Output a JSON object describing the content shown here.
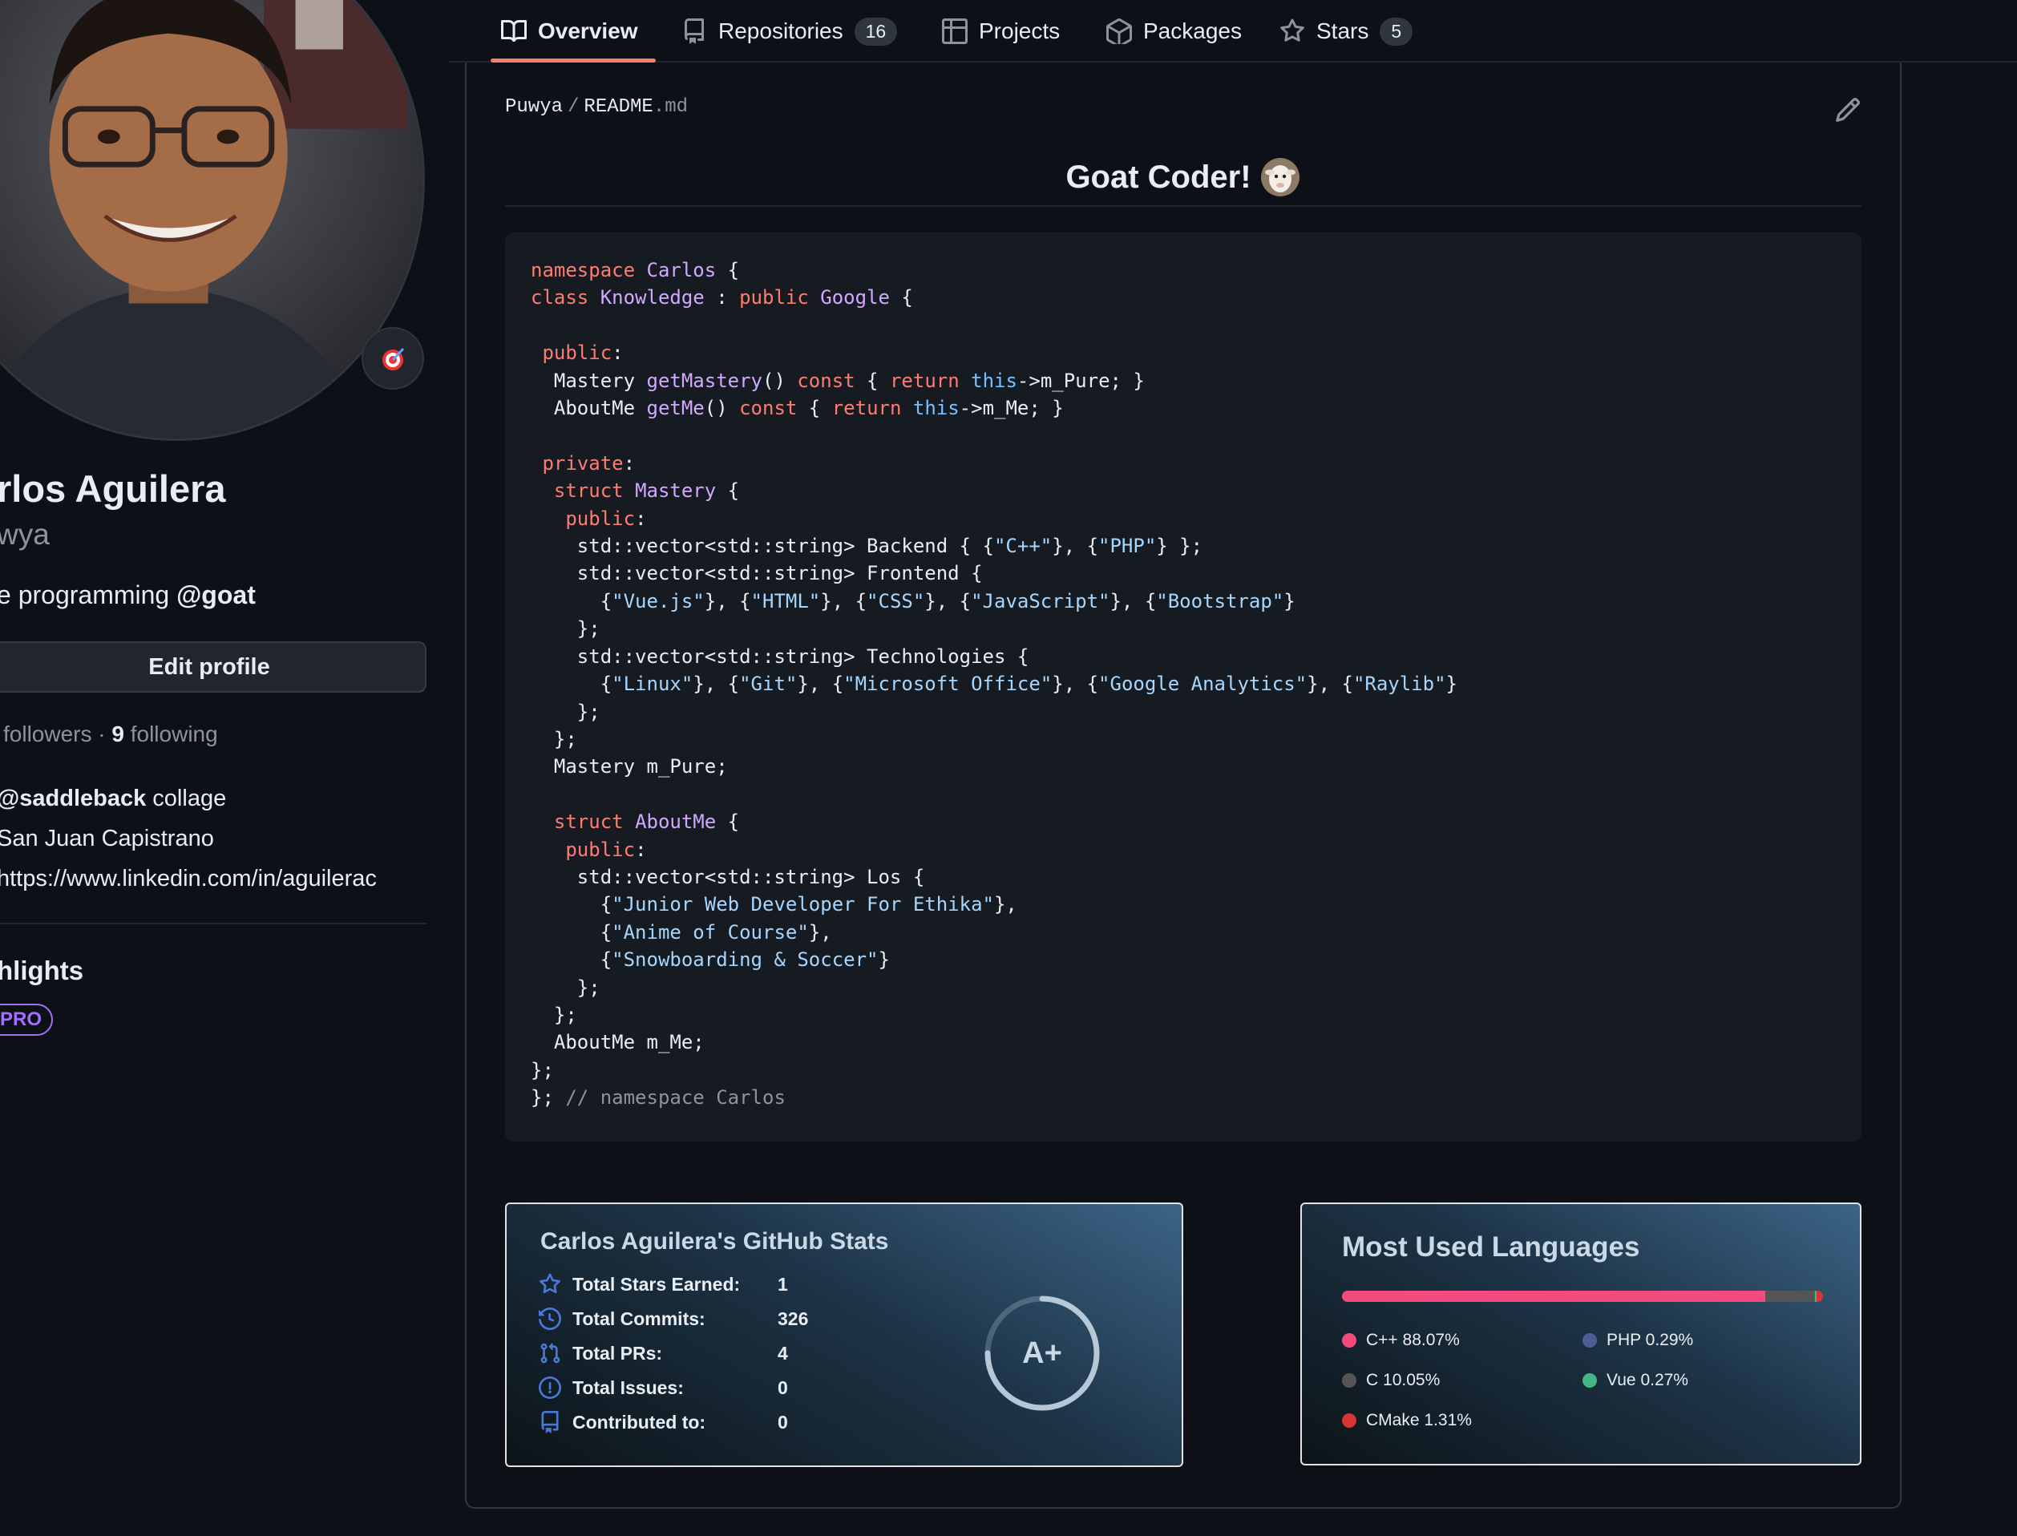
{
  "nav": {
    "tabs": [
      {
        "label": "Overview",
        "icon": "book-icon",
        "count": null
      },
      {
        "label": "Repositories",
        "icon": "repo-icon",
        "count": "16"
      },
      {
        "label": "Projects",
        "icon": "table-icon",
        "count": null
      },
      {
        "label": "Packages",
        "icon": "package-icon",
        "count": null
      },
      {
        "label": "Stars",
        "icon": "star-icon",
        "count": "5"
      }
    ],
    "active_tab": "Overview"
  },
  "profile": {
    "name": "rlos Aguilera",
    "login": "wya",
    "bio_text": "e programming ",
    "bio_mention": "@goat",
    "edit_profile_label": "Edit profile",
    "followers_text": " followers · ",
    "following_count": "9",
    "following_text": " following",
    "org_mention": "@saddleback",
    "org_text": " collage",
    "location": "San Juan Capistrano",
    "website": "https://www.linkedin.com/in/aguilerac",
    "highlights_title": "hlights",
    "pro_badge": "PRO"
  },
  "readme": {
    "owner": "Puwya",
    "file_base": "README",
    "file_ext": ".md",
    "title": "Goat Coder!",
    "title_emoji": "goat-emoji",
    "code_lines": [
      "namespace Carlos {",
      "class Knowledge : public Google {",
      "",
      " public:",
      "  Mastery getMastery() const { return this->m_Pure; }",
      "  AboutMe getMe() const { return this->m_Me; }",
      "",
      " private:",
      "  struct Mastery {",
      "   public:",
      "    std::vector<std::string> Backend { {\"C++\"}, {\"PHP\"} };",
      "    std::vector<std::string> Frontend {",
      "      {\"Vue.js\"}, {\"HTML\"}, {\"CSS\"}, {\"JavaScript\"}, {\"Bootstrap\"}",
      "    };",
      "    std::vector<std::string> Technologies {",
      "      {\"Linux\"}, {\"Git\"}, {\"Microsoft Office\"}, {\"Google Analytics\"}, {\"Raylib\"}",
      "    };",
      "  };",
      "  Mastery m_Pure;",
      "",
      "  struct AboutMe {",
      "   public:",
      "    std::vector<std::string> Los {",
      "      {\"Junior Web Developer For Ethika\"},",
      "      {\"Anime of Course\"},",
      "      {\"Snowboarding & Soccer\"}",
      "    };",
      "  };",
      "  AboutMe m_Me;",
      "};",
      "}; // namespace Carlos"
    ]
  },
  "stats_card": {
    "title": "Carlos Aguilera's GitHub Stats",
    "rows": [
      {
        "icon": "star-icon",
        "label": "Total Stars Earned:",
        "value": "1"
      },
      {
        "icon": "history-icon",
        "label": "Total Commits:",
        "value": "326"
      },
      {
        "icon": "pull-request-icon",
        "label": "Total PRs:",
        "value": "4"
      },
      {
        "icon": "issue-icon",
        "label": "Total Issues:",
        "value": "0"
      },
      {
        "icon": "repo-icon",
        "label": "Contributed to:",
        "value": "0"
      }
    ],
    "grade": "A+",
    "grade_progress": 0.75,
    "accent_color": "#4b78d6"
  },
  "languages_card": {
    "title": "Most Used Languages",
    "languages": [
      {
        "name": "C++",
        "percent_text": "88.07%",
        "percent": 88.07,
        "color": "#f34b7d"
      },
      {
        "name": "PHP",
        "percent_text": "0.29%",
        "percent": 0.29,
        "color": "#4F5D95"
      },
      {
        "name": "C",
        "percent_text": "10.05%",
        "percent": 10.05,
        "color": "#555555"
      },
      {
        "name": "Vue",
        "percent_text": "0.27%",
        "percent": 0.27,
        "color": "#41b883"
      },
      {
        "name": "CMake",
        "percent_text": "1.31%",
        "percent": 1.31,
        "color": "#DA3434"
      }
    ]
  },
  "colors": {
    "background": "#0d1117",
    "tab_underline": "#f78166",
    "pro_badge": "#a371f7"
  }
}
